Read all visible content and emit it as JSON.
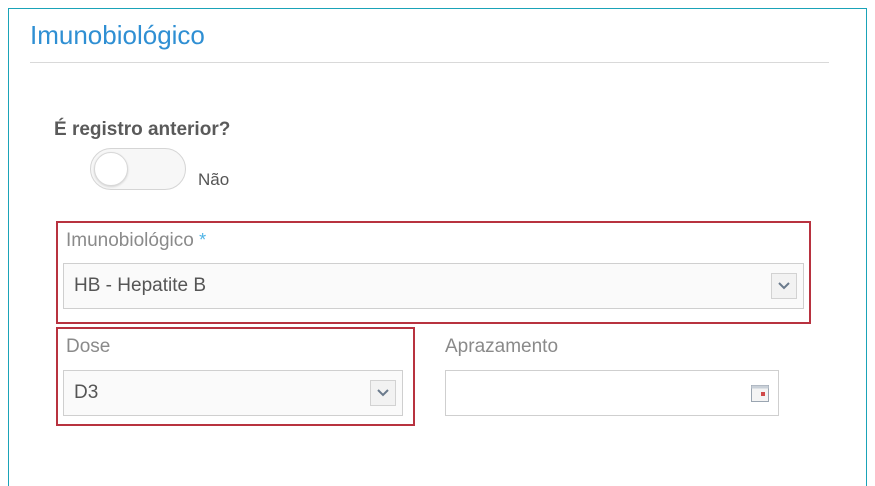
{
  "section": {
    "title": "Imunobiológico"
  },
  "previous_record": {
    "question": "É registro anterior?",
    "toggle_state": "off",
    "toggle_label": "Não"
  },
  "imunobiologico_field": {
    "label": "Imunobiológico",
    "required_marker": "*",
    "value": "HB - Hepatite B",
    "icon": "chevron-down-icon"
  },
  "dose_field": {
    "label": "Dose",
    "value": "D3",
    "icon": "chevron-down-icon"
  },
  "aprazamento_field": {
    "label": "Aprazamento",
    "value": "",
    "icon": "calendar-icon"
  },
  "colors": {
    "accent": "#2f8fd3",
    "panel_border": "#1aa3b8",
    "error_border": "#b8323f",
    "required": "#4db3e6"
  }
}
